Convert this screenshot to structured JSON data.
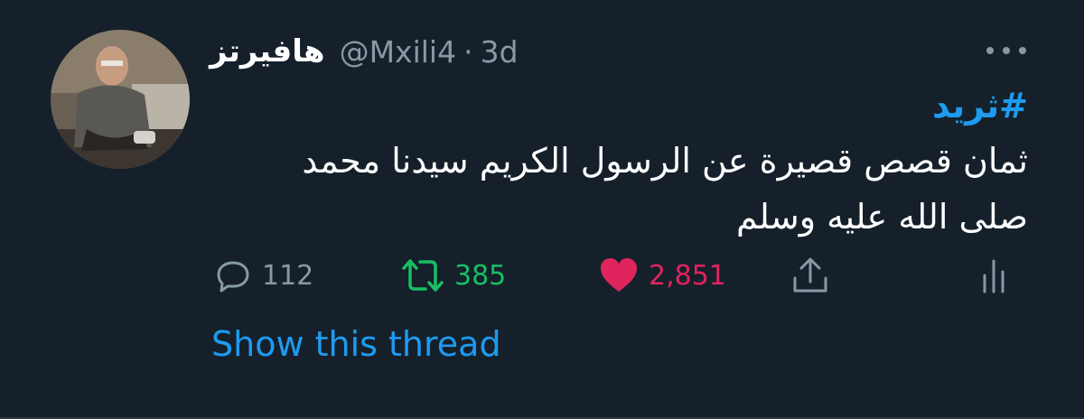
{
  "tweet": {
    "display_name": "هافيرتز",
    "handle": "@Mxili4",
    "separator": "·",
    "time": "3d",
    "hashtag": "#ثريد",
    "text_line1": "ثمان قصص قصيرة عن الرسول الكريم سيدنا محمد",
    "text_line2": "صلى الله عليه وسلم",
    "show_thread": "Show this thread"
  },
  "actions": {
    "replies": "112",
    "retweets": "385",
    "likes": "2,851"
  },
  "icons": {
    "more": "more-horizontal-icon",
    "reply": "reply-icon",
    "retweet": "retweet-icon",
    "like": "heart-icon",
    "share": "share-icon",
    "analytics": "analytics-icon"
  },
  "colors": {
    "background": "#15202b",
    "link": "#1d9bf0",
    "muted": "#8899a6",
    "retweet": "#17bf63",
    "like": "#e0245e"
  }
}
